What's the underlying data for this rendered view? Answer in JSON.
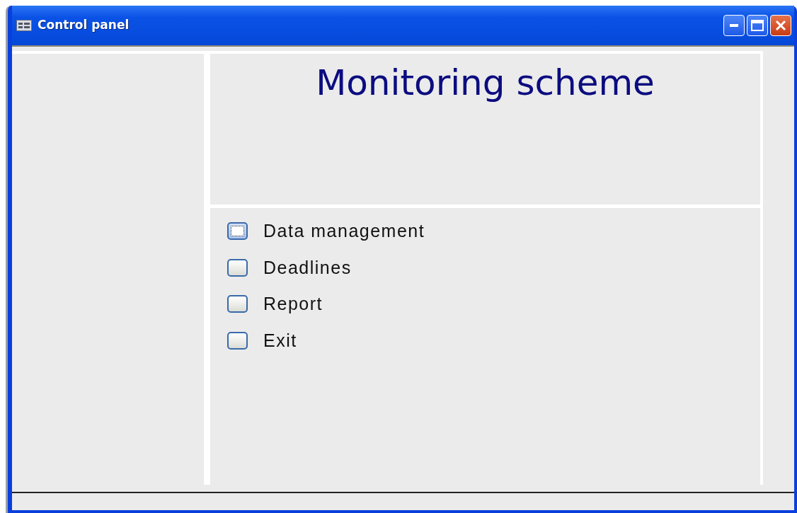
{
  "window": {
    "title": "Control panel"
  },
  "heading": "Monitoring scheme",
  "menu_items": [
    {
      "label": "Data management",
      "selected": true
    },
    {
      "label": "Deadlines",
      "selected": false
    },
    {
      "label": "Report",
      "selected": false
    },
    {
      "label": "Exit",
      "selected": false
    }
  ]
}
